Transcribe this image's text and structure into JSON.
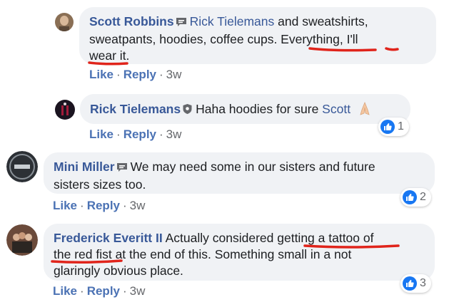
{
  "comments": [
    {
      "author": "Scott Robbins",
      "mention": "Rick Tielemans",
      "text_a": " and sweatshirts,",
      "line2": "sweatpants, hoodies, coffee cups. Everything, I'll",
      "line3": "wear it.",
      "actions": {
        "like": "Like",
        "reply": "Reply",
        "time": "3w"
      }
    },
    {
      "author": "Rick Tielemans",
      "text_a": "Haha hoodies for sure ",
      "mention": "Scott",
      "reaction_count": "1",
      "actions": {
        "like": "Like",
        "reply": "Reply",
        "time": "3w"
      }
    },
    {
      "author": "Mini Miller",
      "line1": "We may need some in our sisters and future",
      "line2": "sisters sizes too.",
      "reaction_count": "2",
      "actions": {
        "like": "Like",
        "reply": "Reply",
        "time": "3w"
      }
    },
    {
      "author": "Frederick Everitt II",
      "line1": "Actually considered getting a tattoo of",
      "line2": "the red fist at the end of this. Something small in a not",
      "line3": "glaringly obvious place.",
      "reaction_count": "3",
      "actions": {
        "like": "Like",
        "reply": "Reply",
        "time": "3w"
      }
    }
  ],
  "colors": {
    "name": "#385898",
    "bubble": "#f0f2f5",
    "like": "#1877f2",
    "annotation": "#e0241b"
  },
  "icons": [
    "speech-bubble-badge-icon",
    "shield-badge-icon",
    "pray-emoji-icon",
    "thumbs-up-icon"
  ]
}
